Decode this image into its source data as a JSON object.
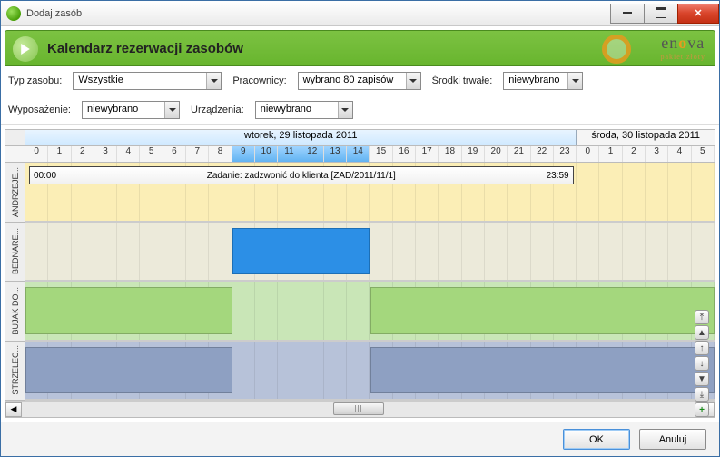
{
  "window": {
    "title": "Dodaj zasób"
  },
  "banner": {
    "heading": "Kalendarz rezerwacji zasobów",
    "logo_main": "en",
    "logo_o": "o",
    "logo_va": "va",
    "logo_sub": "pakiet złoty"
  },
  "filters": {
    "typ_label": "Typ zasobu:",
    "typ_value": "Wszystkie",
    "pracownicy_label": "Pracownicy:",
    "pracownicy_value": "wybrano 80 zapisów",
    "srodki_label": "Środki trwałe:",
    "srodki_value": "niewybrano",
    "wyposazenie_label": "Wyposażenie:",
    "wyposazenie_value": "niewybrano",
    "urzadzenia_label": "Urządzenia:",
    "urzadzenia_value": "niewybrano"
  },
  "calendar": {
    "day1": "wtorek, 29 listopada 2011",
    "day2": "środa, 30 listopada 2011",
    "hours_day1": [
      "0",
      "1",
      "2",
      "3",
      "4",
      "5",
      "6",
      "7",
      "8",
      "9",
      "10",
      "11",
      "12",
      "13",
      "14",
      "15",
      "16",
      "17",
      "18",
      "19",
      "20",
      "21",
      "22",
      "23"
    ],
    "hours_day2": [
      "0",
      "1",
      "2",
      "3",
      "4",
      "5"
    ],
    "current_range_start": 9,
    "current_range_end": 15,
    "rows": [
      {
        "id": "andrzej",
        "label": "ANDRZEJE...",
        "blocks": [],
        "task": {
          "start": "00:00",
          "end": "23:59",
          "text": "Zadanie: zadzwonić do klienta [ZAD/2011/11/1]"
        }
      },
      {
        "id": "bednar",
        "label": "BEDNARE...",
        "blocks": [
          {
            "from": 9,
            "to": 15
          }
        ]
      },
      {
        "id": "bujak",
        "label": "BUJAK DO...",
        "blocks": [
          {
            "from": 0,
            "to": 9
          },
          {
            "from": 15,
            "to": 30
          }
        ]
      },
      {
        "id": "strzel",
        "label": "STRZELEC...",
        "blocks": [
          {
            "from": 0,
            "to": 9
          },
          {
            "from": 15,
            "to": 30
          }
        ]
      }
    ]
  },
  "footer": {
    "ok": "OK",
    "cancel": "Anuluj"
  }
}
